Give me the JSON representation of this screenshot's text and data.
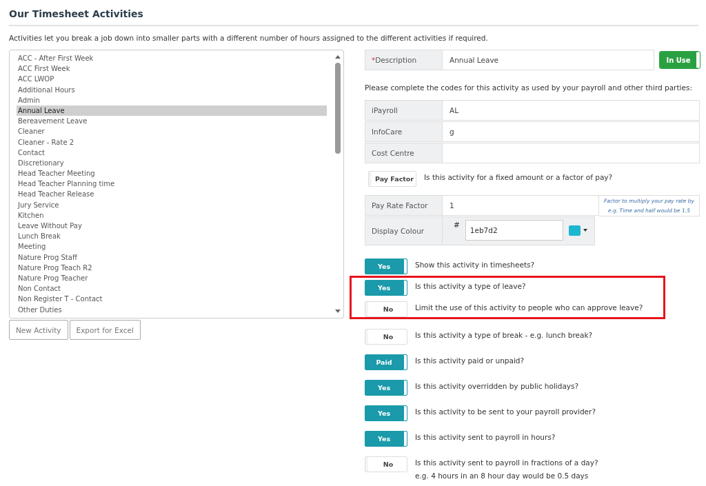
{
  "title": "Our Timesheet Activities",
  "intro": "Activities let you break a job down into smaller parts with a different number of hours assigned to the different activities if required.",
  "activities": [
    {
      "label": "ACC - After First Week",
      "selected": false
    },
    {
      "label": "ACC First Week",
      "selected": false
    },
    {
      "label": "ACC LWOP",
      "selected": false
    },
    {
      "label": "Additional Hours",
      "selected": false
    },
    {
      "label": "Admin",
      "selected": false
    },
    {
      "label": "Annual Leave",
      "selected": true
    },
    {
      "label": "Bereavement Leave",
      "selected": false
    },
    {
      "label": "Cleaner",
      "selected": false
    },
    {
      "label": "Cleaner - Rate 2",
      "selected": false
    },
    {
      "label": "Contact",
      "selected": false
    },
    {
      "label": "Discretionary",
      "selected": false
    },
    {
      "label": "Head Teacher Meeting",
      "selected": false
    },
    {
      "label": "Head Teacher Planning time",
      "selected": false
    },
    {
      "label": "Head Teacher Release",
      "selected": false
    },
    {
      "label": "Jury Service",
      "selected": false
    },
    {
      "label": "Kitchen",
      "selected": false
    },
    {
      "label": "Leave Without Pay",
      "selected": false
    },
    {
      "label": "Lunch Break",
      "selected": false
    },
    {
      "label": "Meeting",
      "selected": false
    },
    {
      "label": "Nature Prog Staff",
      "selected": false
    },
    {
      "label": "Nature Prog Teach R2",
      "selected": false
    },
    {
      "label": "Nature Prog Teacher",
      "selected": false
    },
    {
      "label": "Non Contact",
      "selected": false
    },
    {
      "label": "Non Register T - Contact",
      "selected": false
    },
    {
      "label": "Other Duties",
      "selected": false
    }
  ],
  "list_buttons": [
    "New Activity",
    "Export for Excel"
  ],
  "description": {
    "required_mark": "*",
    "label": "Description",
    "value": "Annual Leave"
  },
  "in_use": {
    "label": "In Use",
    "on": true
  },
  "codes_intro": "Please complete the codes for this activity as used by your payroll and other third parties:",
  "codes": [
    {
      "label": "iPayroll",
      "value": "AL"
    },
    {
      "label": "InfoCare",
      "value": "g"
    },
    {
      "label": "Cost Centre"
    }
  ],
  "pay_type": {
    "label": "Pay Factor",
    "on": false,
    "question": "Is this activity for a fixed amount or a factor of pay?"
  },
  "pay_rate": {
    "label": "Pay Rate Factor",
    "value": "1",
    "help": "Factor to multiply your pay rate by e.g. Time and half would be 1.5"
  },
  "display_colour": {
    "label": "Display Colour",
    "hash": "#",
    "value": "1eb7d2",
    "color": "#1eb7d2"
  },
  "toggles": [
    {
      "label": "Yes",
      "on": true,
      "highlighted": false,
      "question": "Show this activity in timesheets?"
    },
    {
      "label": "Yes",
      "on": true,
      "highlighted": true,
      "question": "Is this activity a type of leave?"
    },
    {
      "label": "No",
      "on": false,
      "highlighted": true,
      "question": "Limit the use of this activity to people who can approve leave?"
    },
    {
      "label": "No",
      "on": false,
      "highlighted": false,
      "question": "Is this activity a type of break - e.g. lunch break?"
    },
    {
      "label": "Paid",
      "on": true,
      "highlighted": false,
      "question": "Is this activity paid or unpaid?"
    },
    {
      "label": "Yes",
      "on": true,
      "highlighted": false,
      "question": "Is this activity overridden by public holidays?"
    },
    {
      "label": "Yes",
      "on": true,
      "highlighted": false,
      "question": "Is this activity to be sent to your payroll provider?"
    },
    {
      "label": "Yes",
      "on": true,
      "highlighted": false,
      "question": "Is this activity sent to payroll in hours?"
    },
    {
      "label": "No",
      "on": false,
      "highlighted": false,
      "question": "Is this activity sent to payroll in fractions of a day?",
      "note": "e.g. 4 hours in an 8 hour day would be 0.5 days"
    }
  ]
}
